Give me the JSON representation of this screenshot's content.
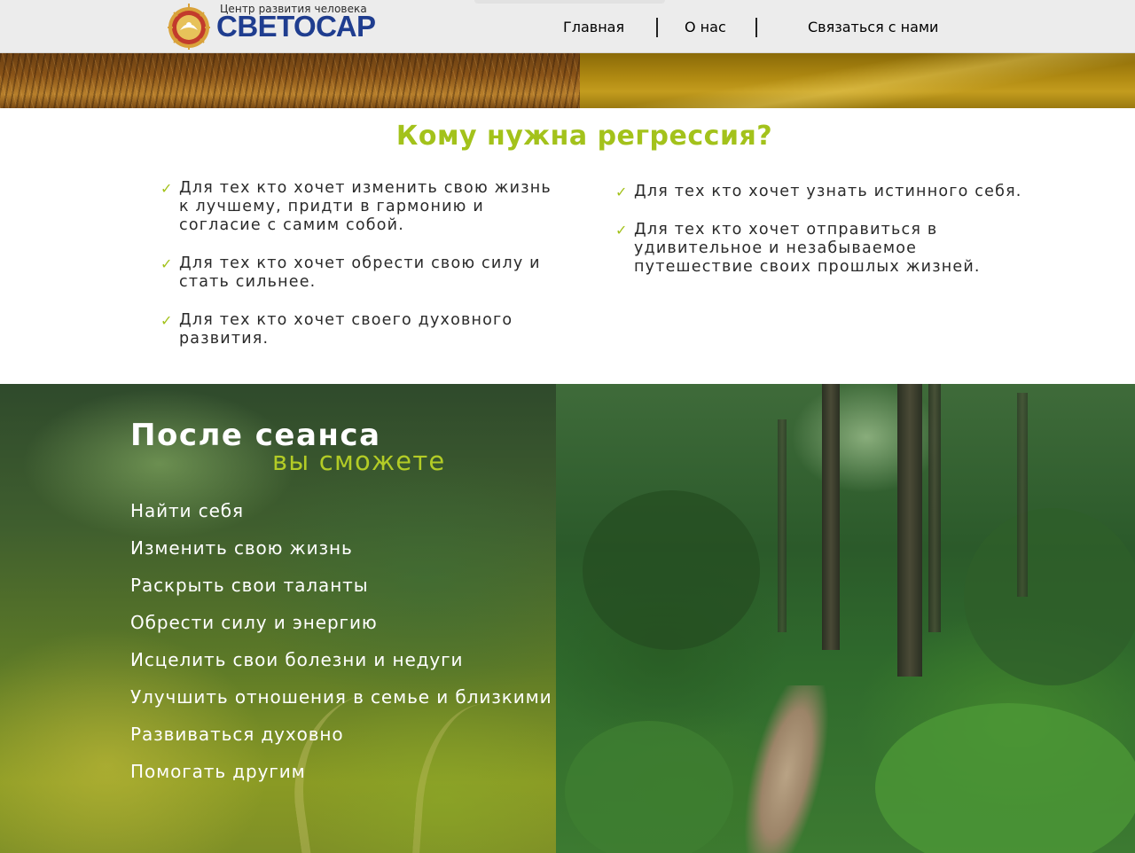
{
  "header": {
    "logo_tagline": "Центр развития человека",
    "logo_name": "СВЕТОСАР",
    "nav": [
      {
        "label": "Главная"
      },
      {
        "label": "О нас"
      },
      {
        "label": "Связаться с нами"
      }
    ]
  },
  "who_needs": {
    "title": "Кому нужна регрессия?",
    "left_items": [
      "Для тех кто хочет изменить свою жизнь к лучшему, придти в гармонию и согласие с самим собой.",
      "Для тех кто хочет обрести свою силу и стать сильнее.",
      "Для тех кто хочет своего духовного развития."
    ],
    "right_items": [
      "Для тех кто хочет узнать истинного себя.",
      "Для тех кто хочет отправиться в удивительное и незабываемое путешествие своих прошлых жизней."
    ],
    "check_icon": "check-icon",
    "accent_color": "#a3c21b"
  },
  "after_session": {
    "title": "После сеанса",
    "subtitle": "вы сможете",
    "benefits": [
      "Найти себя",
      "Изменить свою жизнь",
      "Раскрыть свои таланты",
      "Обрести силу и энергию",
      "Исцелить свои болезни и недуги",
      "Улучшить отношения в семье и близкими",
      "Развиваться духовно",
      "Помогать другим"
    ]
  }
}
